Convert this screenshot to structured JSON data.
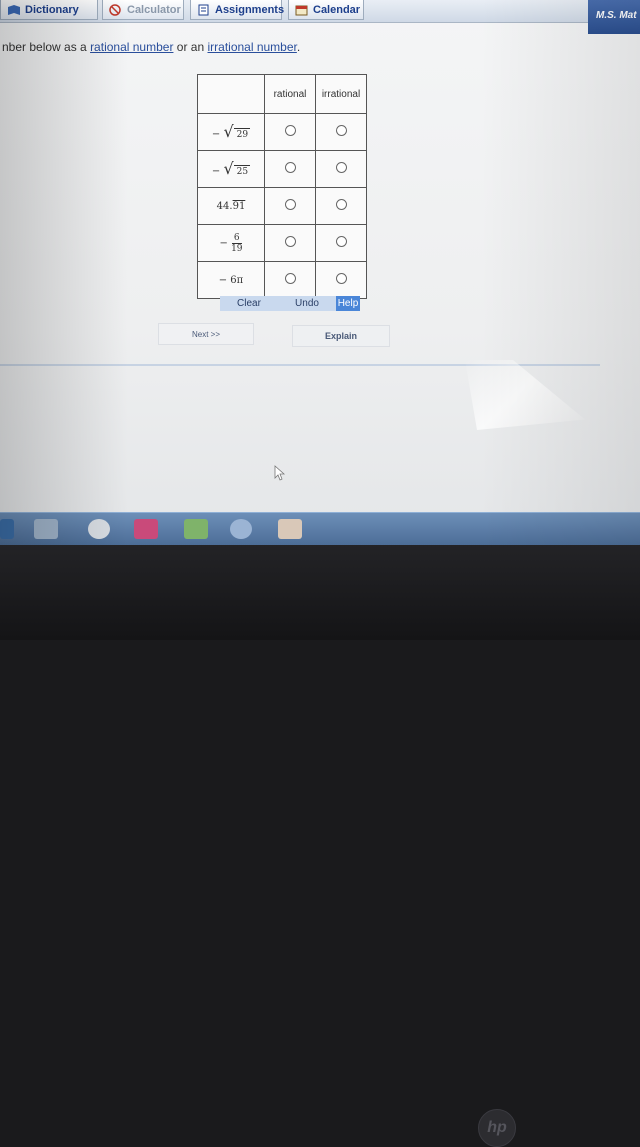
{
  "toolbar": {
    "dictionary": "Dictionary",
    "calculator": "Calculator",
    "assignments": "Assignments",
    "calendar": "Calendar",
    "user": "M.S. Mat"
  },
  "instruction": {
    "prefix": "nber below as a ",
    "link1": "rational number",
    "middle": " or an ",
    "link2": "irrational number",
    "suffix": "."
  },
  "table": {
    "headers": [
      "rational",
      "irrational"
    ],
    "rows": [
      {
        "sign": "−",
        "radicand": "29"
      },
      {
        "sign": "−",
        "radicand": "25"
      },
      {
        "whole": "44.",
        "repeating": "91"
      },
      {
        "sign": "−",
        "numerator": "6",
        "denominator": "19"
      },
      {
        "text": "− 6π"
      }
    ]
  },
  "actions": {
    "clear": "Clear",
    "undo": "Undo",
    "help": "Help"
  },
  "nav": {
    "next": "Next >>",
    "explain": "Explain"
  },
  "bezel": {
    "logo": "hp"
  },
  "colors": {
    "link": "#2a4f9c",
    "help_bg": "#4a86d8",
    "taskbar": "#5a7ca6"
  }
}
